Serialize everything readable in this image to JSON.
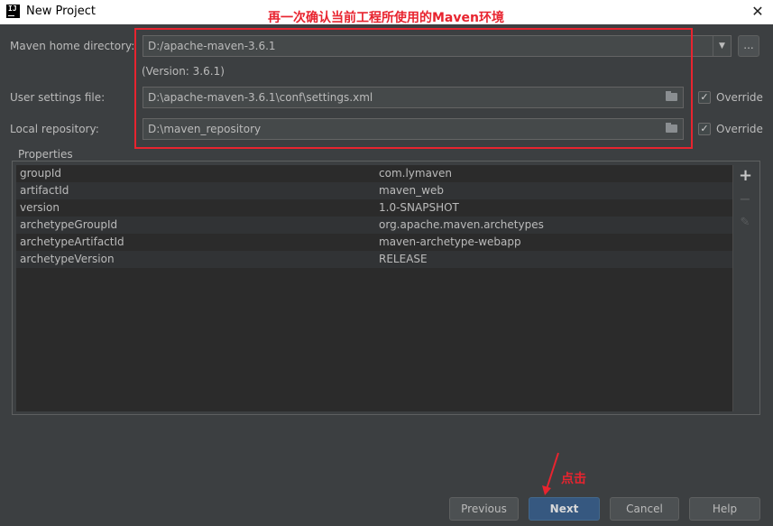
{
  "window": {
    "title": "New Project",
    "app_icon_text": "IJ",
    "close_glyph": "✕"
  },
  "annotations": {
    "title_note": "再一次确认当前工程所使用的Maven环境",
    "click_note": "点击",
    "color": "#e8242f"
  },
  "form": {
    "maven_home": {
      "label": "Maven home directory:",
      "value": "D:/apache-maven-3.6.1",
      "version_text": "(Version: 3.6.1)",
      "browse_label": "..."
    },
    "user_settings": {
      "label": "User settings file:",
      "value": "D:\\apache-maven-3.6.1\\conf\\settings.xml",
      "override_label": "Override",
      "override_checked": true
    },
    "local_repo": {
      "label": "Local repository:",
      "value": "D:\\maven_repository",
      "override_label": "Override",
      "override_checked": true
    }
  },
  "properties": {
    "group_title": "Properties",
    "rows": [
      {
        "key": "groupId",
        "value": "com.lymaven"
      },
      {
        "key": "artifactId",
        "value": "maven_web"
      },
      {
        "key": "version",
        "value": "1.0-SNAPSHOT"
      },
      {
        "key": "archetypeGroupId",
        "value": "org.apache.maven.archetypes"
      },
      {
        "key": "archetypeArtifactId",
        "value": "maven-archetype-webapp"
      },
      {
        "key": "archetypeVersion",
        "value": "RELEASE"
      }
    ],
    "toolbar": {
      "add_glyph": "+",
      "remove_glyph": "−",
      "edit_glyph": "✎"
    }
  },
  "buttons": {
    "previous": "Previous",
    "next": "Next",
    "cancel": "Cancel",
    "help": "Help"
  },
  "colors": {
    "background": "#3c3f41",
    "table_bg": "#2b2b2b",
    "primary_button": "#365880"
  }
}
